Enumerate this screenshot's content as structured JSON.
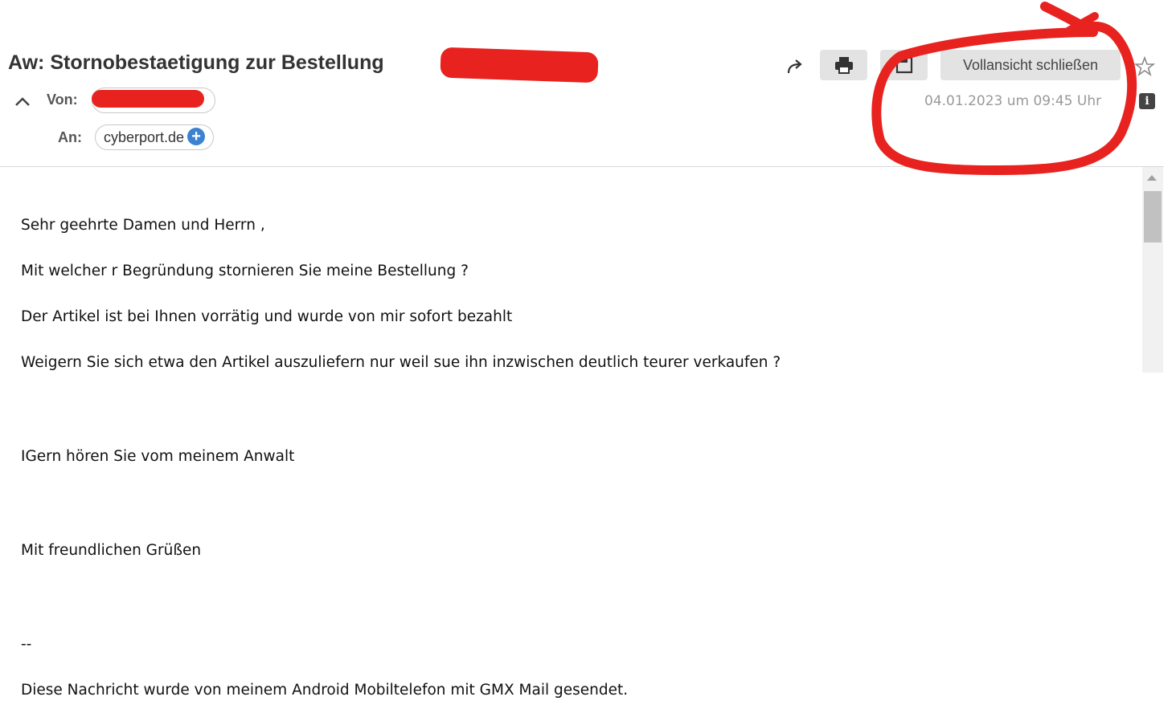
{
  "message": {
    "subject": "Aw: Stornobestaetigung zur Bestellung",
    "from_label": "Von:",
    "to_label": "An:",
    "to_recipient": "cyberport.de",
    "date": "04.01.2023 um 09:45 Uhr",
    "body_lines": [
      "Sehr geehrte Damen und Herrn ,",
      "Mit welcher r Begründung stornieren Sie meine Bestellung ?",
      "Der Artikel ist bei Ihnen vorrätig und wurde von mir sofort bezahlt",
      "Weigern Sie sich etwa den Artikel auszuliefern nur weil sue ihn inzwischen deutlich teurer verkaufen ?",
      "",
      "IGern hören Sie vom meinem Anwalt",
      "",
      "Mit freundlichen Grüßen",
      "",
      "--",
      "Diese Nachricht wurde von meinem Android Mobiltelefon mit GMX Mail gesendet."
    ]
  },
  "toolbar": {
    "close_fullview_label": "Vollansicht schließen",
    "icons": [
      "forward-icon",
      "print-icon",
      "save-icon",
      "star-icon"
    ]
  },
  "colors": {
    "annotation_red": "#e8221f",
    "accent_blue": "#3b83d0"
  }
}
